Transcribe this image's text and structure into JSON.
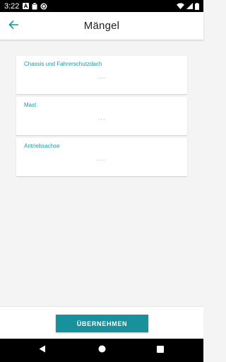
{
  "status_bar": {
    "time": "3:22",
    "left_icons": [
      "a-notification-icon",
      "clipboard-icon",
      "sync-circle-icon"
    ],
    "right_icons": [
      "wifi-icon",
      "signal-icon",
      "battery-icon"
    ]
  },
  "app_bar": {
    "title": "Mängel",
    "back_icon": "arrow-left-icon",
    "accent_color": "#17919b"
  },
  "cards": [
    {
      "title": "Chassis und Fahrerschutzdach",
      "value": "···"
    },
    {
      "title": "Mast",
      "value": "···"
    },
    {
      "title": "Antriebsachse",
      "value": "···"
    }
  ],
  "actions": {
    "apply_label": "ÜBERNEHMEN"
  },
  "nav_bar": {
    "icons": [
      "back-triangle-icon",
      "home-circle-icon",
      "recents-square-icon"
    ]
  },
  "colors": {
    "accent": "#17919b",
    "card_title": "#1a9aa6",
    "background": "#f4f4f4"
  }
}
